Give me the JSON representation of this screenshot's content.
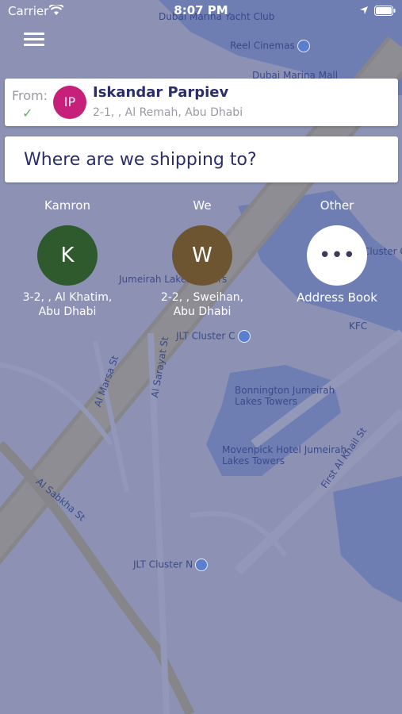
{
  "status_bar": {
    "carrier": "Carrier",
    "time": "8:07 PM"
  },
  "map": {
    "labels": [
      "Dubai Marina Yacht Club",
      "Reel Cinemas",
      "Dubai Marina Mall",
      "Jumeirah Lakes Towers",
      "JLT Cluster C",
      "KFC",
      "Bonnington Jumeirah Lakes Towers",
      "Movenpick Hotel Jumeirah Lakes Towers",
      "JLT Cluster N",
      "Al Sarayat St",
      "Al Marsa St",
      "Al Sabkha St",
      "First Al Khail St",
      "Cluster G"
    ]
  },
  "from": {
    "label": "From:",
    "avatar_initials": "IP",
    "avatar_color": "#c6207a",
    "name": "Iskandar Parpiev",
    "address": "2-1, , Al Remah, Abu Dhabi"
  },
  "destination": {
    "placeholder": "Where are we shipping to?"
  },
  "recipients": [
    {
      "name": "Kamron",
      "initial": "K",
      "color": "#2e5a2e",
      "address_line1": "3-2, , Al Khatim,",
      "address_line2": "Abu Dhabi"
    },
    {
      "name": "We",
      "initial": "W",
      "color": "#6e5532",
      "address_line1": "2-2, , Sweihan,",
      "address_line2": "Abu Dhabi"
    },
    {
      "name": "Other",
      "initial": "•••",
      "color": "#ffffff",
      "address_line1": "Address Book",
      "address_line2": ""
    }
  ]
}
